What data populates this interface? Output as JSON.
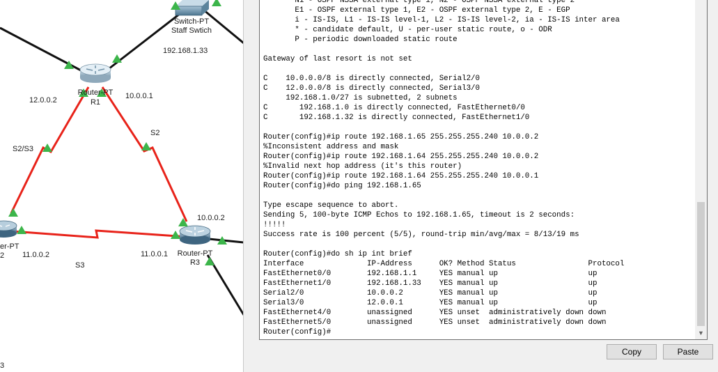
{
  "topology": {
    "devices": [
      {
        "id": "sw",
        "model": "Switch-PT",
        "name": "Staff Swtich"
      },
      {
        "id": "r1",
        "model": "Router-PT",
        "name": "R1"
      },
      {
        "id": "r2",
        "model": "er-PT",
        "name": "2"
      },
      {
        "id": "r3",
        "model": "Router-PT",
        "name": "R3"
      }
    ],
    "labels": {
      "sw_ip": "192.168.1.33",
      "r1_left_ip": "12.0.0.2",
      "r1_right_ip": "10.0.0.1",
      "link_r1_r3": "S2",
      "link_r1_r2": "S2/S3",
      "r3_top_ip": "10.0.0.2",
      "r2_ip": "11.0.0.2",
      "r3_left_ip": "11.0.0.1",
      "link_r2_r3": "S3",
      "bottom_left": "3"
    },
    "colors": {
      "serial_link": "#e8231a",
      "ethernet_link": "#111111",
      "link_up": "#3cb54a"
    }
  },
  "terminal": {
    "lines": [
      "       N1 - OSPF NSSA external type 1, N2 - OSPF NSSA external type 2",
      "       E1 - OSPF external type 1, E2 - OSPF external type 2, E - EGP",
      "       i - IS-IS, L1 - IS-IS level-1, L2 - IS-IS level-2, ia - IS-IS inter area",
      "       * - candidate default, U - per-user static route, o - ODR",
      "       P - periodic downloaded static route",
      "",
      "Gateway of last resort is not set",
      "",
      "C    10.0.0.0/8 is directly connected, Serial2/0",
      "C    12.0.0.0/8 is directly connected, Serial3/0",
      "     192.168.1.0/27 is subnetted, 2 subnets",
      "C       192.168.1.0 is directly connected, FastEthernet0/0",
      "C       192.168.1.32 is directly connected, FastEthernet1/0",
      "",
      "Router(config)#ip route 192.168.1.65 255.255.255.240 10.0.0.2",
      "%Inconsistent address and mask",
      "Router(config)#ip route 192.168.1.64 255.255.255.240 10.0.0.2",
      "%Invalid next hop address (it's this router)",
      "Router(config)#ip route 192.168.1.64 255.255.255.240 10.0.0.1",
      "Router(config)#do ping 192.168.1.65",
      "",
      "Type escape sequence to abort.",
      "Sending 5, 100-byte ICMP Echos to 192.168.1.65, timeout is 2 seconds:",
      "!!!!!",
      "Success rate is 100 percent (5/5), round-trip min/avg/max = 8/13/19 ms",
      "",
      "Router(config)#do sh ip int brief",
      "Interface              IP-Address      OK? Method Status                Protocol",
      "FastEthernet0/0        192.168.1.1     YES manual up                    up",
      "FastEthernet1/0        192.168.1.33    YES manual up                    up",
      "Serial2/0              10.0.0.2        YES manual up                    up",
      "Serial3/0              12.0.0.1        YES manual up                    up",
      "FastEthernet4/0        unassigned      YES unset  administratively down down",
      "FastEthernet5/0        unassigned      YES unset  administratively down down",
      "Router(config)#"
    ]
  },
  "buttons": {
    "copy": "Copy",
    "paste": "Paste"
  }
}
